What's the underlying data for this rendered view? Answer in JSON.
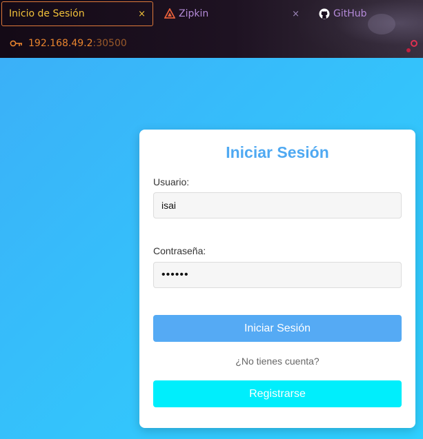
{
  "browser": {
    "tabs": [
      {
        "label": "Inicio de Sesión",
        "icon": "close-icon",
        "active": true
      },
      {
        "label": "Zipkin",
        "icon": "zipkin-icon",
        "active": false
      },
      {
        "label": "GitHub",
        "icon": "github-icon",
        "active": false
      }
    ],
    "url": {
      "host": "192.168.49.2",
      "port": ":30500"
    },
    "close_glyph": "×"
  },
  "login": {
    "title": "Iniciar Sesión",
    "username_label": "Usuario:",
    "username_value": "isai",
    "password_label": "Contraseña:",
    "password_value": "pepito",
    "login_button": "Iniciar Sesión",
    "no_account_text": "¿No tienes cuenta?",
    "register_button": "Registrarse"
  },
  "colors": {
    "background_start": "#3bb0f8",
    "background_end": "#2ed0ff",
    "title": "#4fa9f2",
    "login_button": "#55aaf4",
    "register_button": "#00eefc",
    "tab_active_text": "#f2c23a",
    "tab_text": "#b48ad8",
    "url_text": "#e8842e"
  }
}
